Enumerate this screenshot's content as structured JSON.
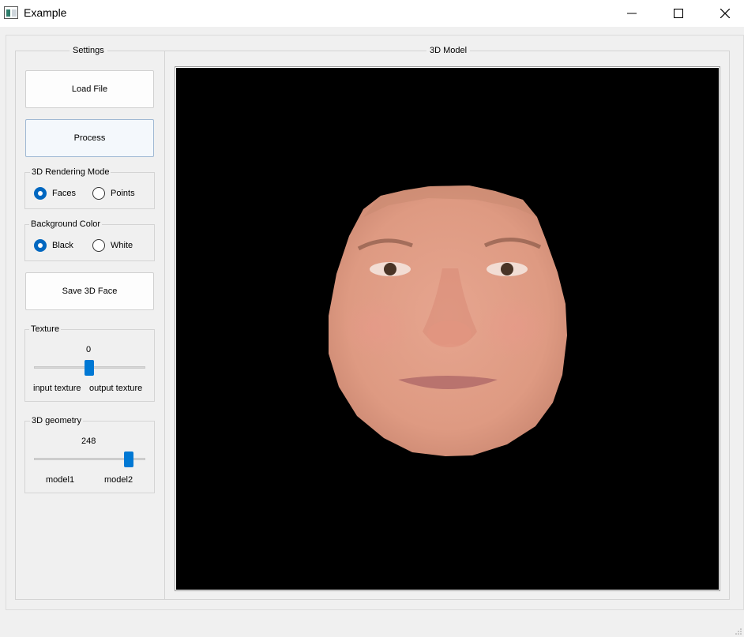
{
  "window": {
    "title": "Example",
    "controls": {
      "minimize_icon": "minimize-icon",
      "maximize_icon": "maximize-icon",
      "close_icon": "close-icon"
    }
  },
  "settings": {
    "group_title": "Settings",
    "load_file_label": "Load File",
    "process_label": "Process",
    "render_mode": {
      "title": "3D Rendering Mode",
      "options": [
        "Faces",
        "Points"
      ],
      "selected": "Faces"
    },
    "background_color": {
      "title": "Background Color",
      "options": [
        "Black",
        "White"
      ],
      "selected": "Black"
    },
    "save_label": "Save 3D Face",
    "texture": {
      "title": "Texture",
      "value": "0",
      "value_fraction": 0.5,
      "min_label": "input texture",
      "max_label": "output texture"
    },
    "geometry": {
      "title": "3D geometry",
      "value": "248",
      "value_fraction": 0.85,
      "min_label": "model1",
      "max_label": "model2"
    }
  },
  "model_view": {
    "group_title": "3D Model",
    "background": "#000000",
    "content": "face-render"
  },
  "colors": {
    "accent": "#0078d4",
    "radio_checked": "#0067c0"
  }
}
